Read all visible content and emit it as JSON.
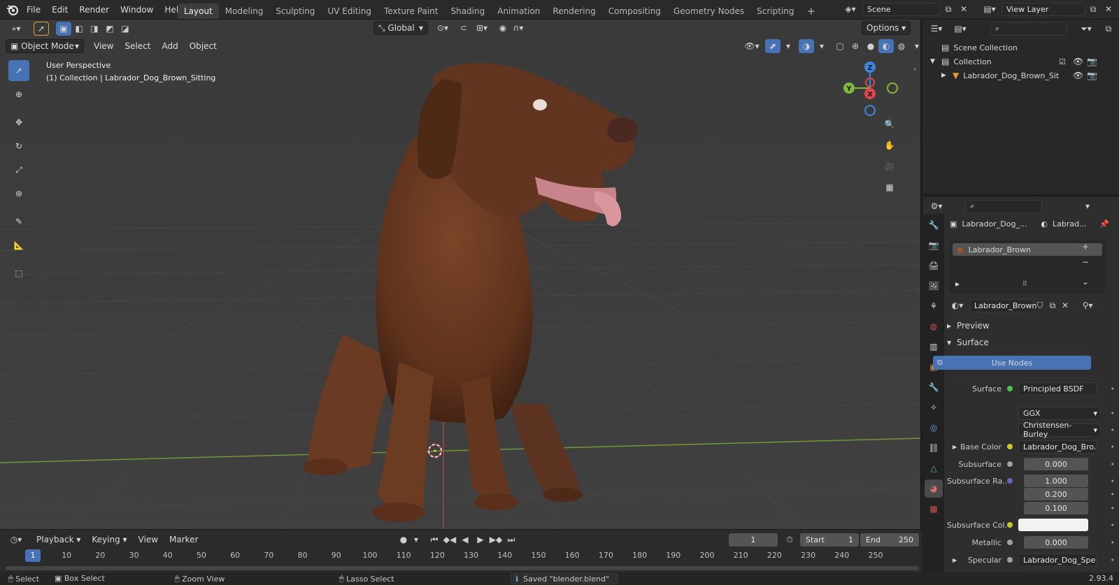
{
  "menu": [
    "File",
    "Edit",
    "Render",
    "Window",
    "Help"
  ],
  "workspaces": [
    "Layout",
    "Modeling",
    "Sculpting",
    "UV Editing",
    "Texture Paint",
    "Shading",
    "Animation",
    "Rendering",
    "Compositing",
    "Geometry Nodes",
    "Scripting"
  ],
  "active_workspace": "Layout",
  "scene": "Scene",
  "view_layer": "View Layer",
  "viewport": {
    "mode": "Object Mode",
    "menus": [
      "View",
      "Select",
      "Add",
      "Object"
    ],
    "orientation": "Global",
    "options": "Options",
    "info_line1": "User Perspective",
    "info_line2": "(1) Collection | Labrador_Dog_Brown_Sitting",
    "gizmo": {
      "z": "Z",
      "y": "Y",
      "x": "X"
    }
  },
  "outliner": {
    "scene_collection": "Scene Collection",
    "collection": "Collection",
    "object": "Labrador_Dog_Brown_Sit"
  },
  "properties": {
    "breadcrumb_object": "Labrador_Dog_...",
    "breadcrumb_material": "Labrad...",
    "slot": "Labrador_Brown",
    "material_name": "Labrador_Brown",
    "preview": "Preview",
    "surface_panel": "Surface",
    "use_nodes": "Use Nodes",
    "rows": [
      {
        "label": "Surface",
        "value": "Principled BSDF",
        "socket": "#4ec04e"
      },
      {
        "label": "",
        "value": "GGX",
        "dropdown": true
      },
      {
        "label": "",
        "value": "Christensen-Burley",
        "dropdown": true
      },
      {
        "label": "Base Color",
        "value": "Labrador_Dog_Bro...",
        "socket": "#c7c729"
      },
      {
        "label": "Subsurface",
        "value": "0.000",
        "socket": "#a0a0a0",
        "numeric": true
      },
      {
        "label": "Subsurface Ra...",
        "value": "1.000",
        "socket": "#6363c7",
        "numeric": true
      },
      {
        "label": "",
        "value": "0.200",
        "numeric": true
      },
      {
        "label": "",
        "value": "0.100",
        "numeric": true
      },
      {
        "label": "Subsurface Col...",
        "value": "",
        "socket": "#c7c729",
        "swatch": "#f2f2f2"
      },
      {
        "label": "Metallic",
        "value": "0.000",
        "socket": "#a0a0a0",
        "numeric": true
      },
      {
        "label": "Specular",
        "value": "Labrador_Dog_Spe...",
        "socket": "#a0a0a0"
      }
    ]
  },
  "timeline": {
    "menus": [
      "Playback",
      "Keying",
      "View",
      "Marker"
    ],
    "current_frame": "1",
    "start_label": "Start",
    "start": "1",
    "end_label": "End",
    "end": "250",
    "ruler": [
      "1",
      "10",
      "20",
      "30",
      "40",
      "50",
      "60",
      "70",
      "80",
      "90",
      "100",
      "110",
      "120",
      "130",
      "140",
      "150",
      "160",
      "170",
      "180",
      "190",
      "200",
      "210",
      "220",
      "230",
      "240",
      "250"
    ]
  },
  "status": {
    "select": "Select",
    "box_select": "Box Select",
    "zoom_view": "Zoom View",
    "lasso_select": "Lasso Select",
    "message": "Saved \"blender.blend\"",
    "version": "2.93.4"
  },
  "colors": {
    "accent": "#4772b3",
    "x_axis": "#e0444e",
    "y_axis": "#7fb83a",
    "z_axis": "#3d86e0"
  }
}
